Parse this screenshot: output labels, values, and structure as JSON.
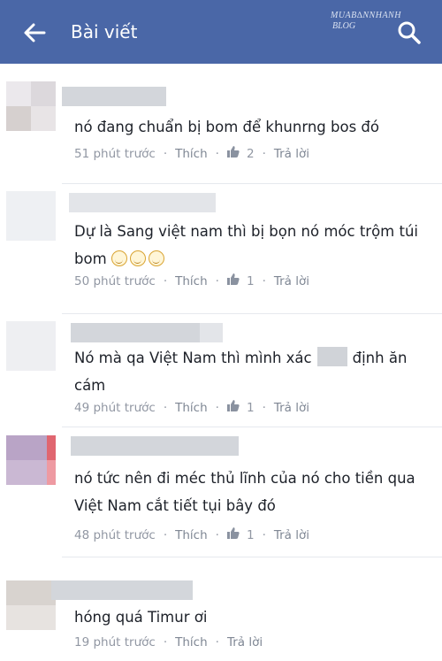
{
  "header": {
    "title": "Bài viết",
    "watermark_line1": "MUAB∆NNHANH",
    "watermark_line2": "BLOG"
  },
  "comments": [
    {
      "text": "nó đang chuẩn bị bom để khunrng bos đó",
      "time": "51 phút trước",
      "like_label": "Thích",
      "likes": "2",
      "reply_label": "Trả lời"
    },
    {
      "text": "Dự là Sang việt nam thì bị bọn nó móc trộm túi bom",
      "time": "50 phút trước",
      "like_label": "Thích",
      "likes": "1",
      "reply_label": "Trả lời"
    },
    {
      "text_before": "Nó mà qa Việt Nam thì mình xác",
      "text_after": "định ăn cám",
      "time": "49 phút trước",
      "like_label": "Thích",
      "likes": "1",
      "reply_label": "Trả lời"
    },
    {
      "text": "nó tức nên đi méc thủ lĩnh của nó cho tiền qua Việt Nam cắt tiết tụi bây đó",
      "time": "48 phút trước",
      "like_label": "Thích",
      "likes": "1",
      "reply_label": "Trả lời"
    },
    {
      "text": "hóng quá Timur ơi",
      "time": "19 phút trước",
      "like_label": "Thích",
      "reply_label": "Trả lời"
    }
  ],
  "colors": {
    "header_bg": "#4a67a7",
    "meta_text": "#9197a3",
    "body_text": "#1d2129"
  },
  "icons": [
    "back-arrow-icon",
    "search-icon",
    "thumbs-up-icon",
    "smile-emoji-icon"
  ]
}
